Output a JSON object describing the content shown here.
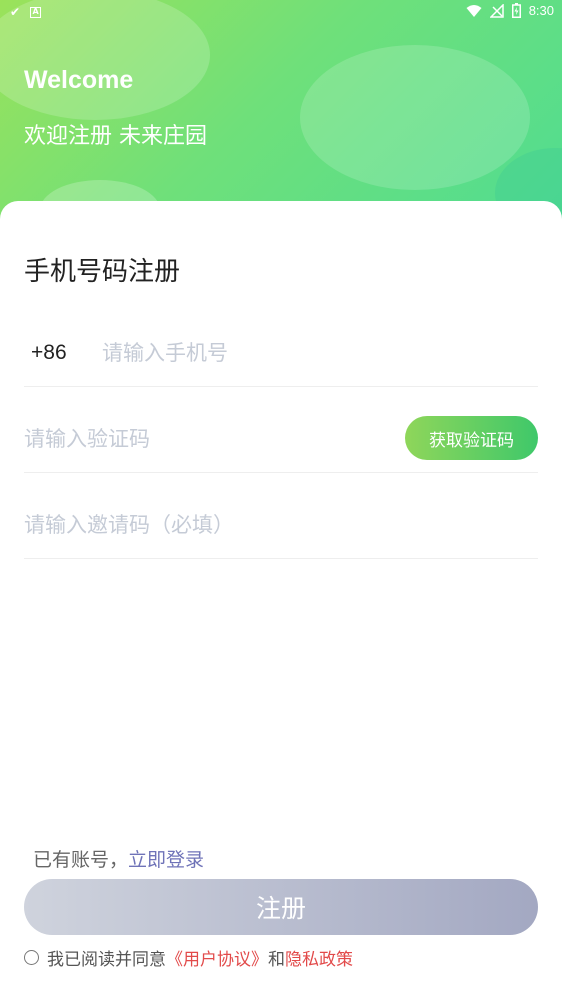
{
  "status_bar": {
    "left_icons": [
      "check-download-icon",
      "text-a-icon"
    ],
    "right_icons": [
      "wifi-icon",
      "no-signal-icon",
      "battery-icon"
    ],
    "time": "8:30"
  },
  "header": {
    "welcome": "Welcome",
    "subtitle": "欢迎注册 未来庄园",
    "gradient_colors": [
      "#9be25a",
      "#4fdc92"
    ]
  },
  "form": {
    "title": "手机号码注册",
    "country_code": "+86",
    "phone_placeholder": "请输入手机号",
    "code_placeholder": "请输入验证码",
    "get_code_label": "获取验证码",
    "invite_placeholder": "请输入邀请码（必填）"
  },
  "footer": {
    "login_prefix": "已有账号，",
    "login_link": "立即登录",
    "register_label": "注册",
    "agree_prefix": "我已阅读并同意",
    "user_agreement": "《用户协议》",
    "and": "和",
    "privacy_policy": "隐私政策",
    "link_color": "#e24a4a",
    "login_link_color": "#6f73b8"
  }
}
